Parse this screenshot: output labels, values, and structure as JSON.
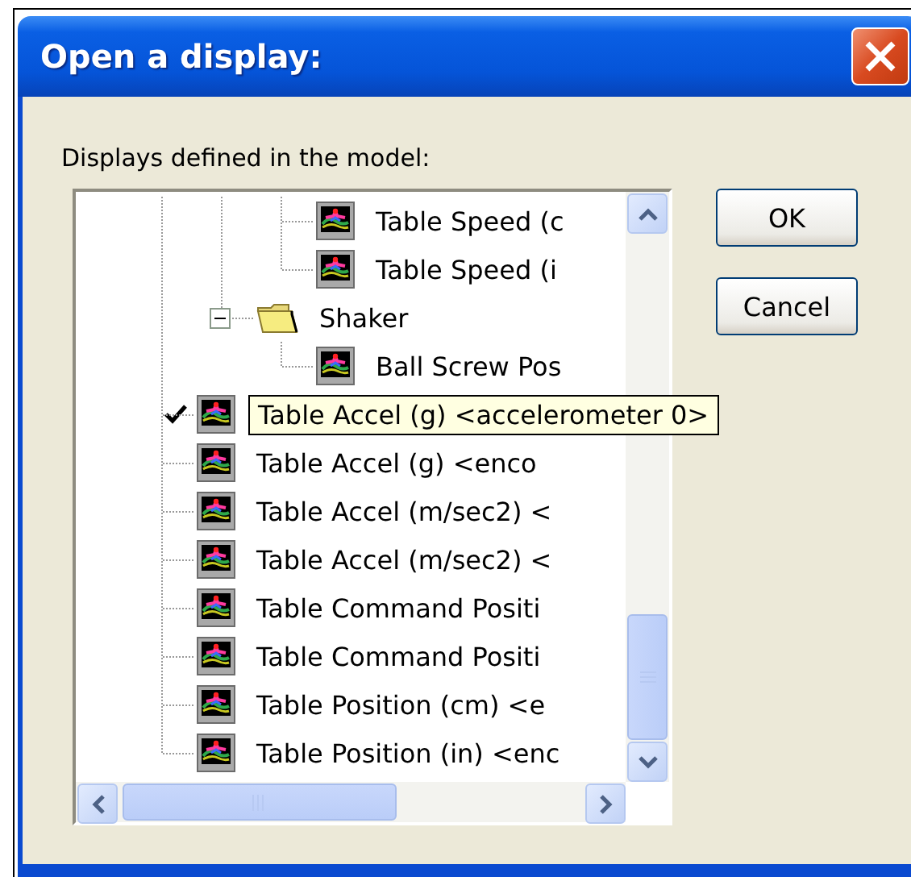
{
  "window": {
    "title": "Open a display:"
  },
  "label": "Displays defined in the model:",
  "tree": [
    {
      "children": [
        {
          "children": [
            {
              "label": "Table Speed (c",
              "kind": "display",
              "checked": false
            },
            {
              "label": "Table Speed (i",
              "kind": "display",
              "checked": false
            }
          ]
        },
        {
          "label": "Shaker",
          "kind": "folder",
          "expanded": true,
          "children": [
            {
              "label": "Ball Screw Pos",
              "kind": "display",
              "checked": false
            }
          ]
        }
      ]
    },
    {
      "kind": "display",
      "checked": true,
      "tooltip": "Table Accel (g) <accelerometer 0>"
    },
    {
      "label": "Table Accel (g) <enco",
      "kind": "display",
      "checked": false
    },
    {
      "label": "Table Accel (m/sec2) <",
      "kind": "display",
      "checked": false
    },
    {
      "label": "Table Accel (m/sec2) <",
      "kind": "display",
      "checked": false
    },
    {
      "label": "Table Command Positi",
      "kind": "display",
      "checked": false
    },
    {
      "label": "Table Command Positi",
      "kind": "display",
      "checked": false
    },
    {
      "label": "Table Position (cm) <e",
      "kind": "display",
      "checked": false
    },
    {
      "label": "Table Position (in) <enc",
      "kind": "display",
      "checked": false
    }
  ],
  "buttons": [
    "OK",
    "Cancel"
  ]
}
